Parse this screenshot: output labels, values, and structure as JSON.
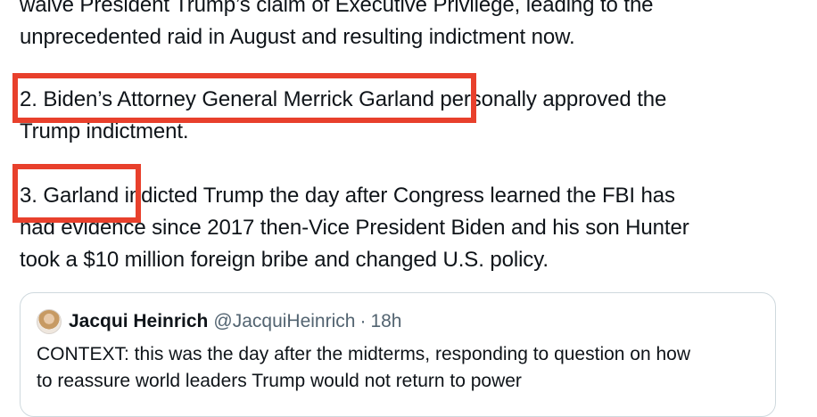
{
  "tweet": {
    "lines": [
      "waive President Trump’s claim of Executive Privilege, leading to the",
      "unprecedented raid in August and resulting indictment now.",
      "2. Biden’s Attorney General Merrick Garland personally approved the",
      "Trump indictment.",
      "3. Garland indicted Trump the day after Congress learned the FBI has",
      "had evidence since 2017 then-Vice President Biden and his son Hunter",
      "took a $10 million foreign bribe and changed U.S. policy."
    ]
  },
  "highlight_color": "#e8402c",
  "quoted_tweet": {
    "author_name": "Jacqui Heinrich",
    "handle": "@JacquiHeinrich",
    "separator": "·",
    "time": "18h",
    "text_lines": [
      "CONTEXT: this was the day after the midterms, responding to question on how",
      "to reassure world leaders Trump would not return to power"
    ]
  }
}
